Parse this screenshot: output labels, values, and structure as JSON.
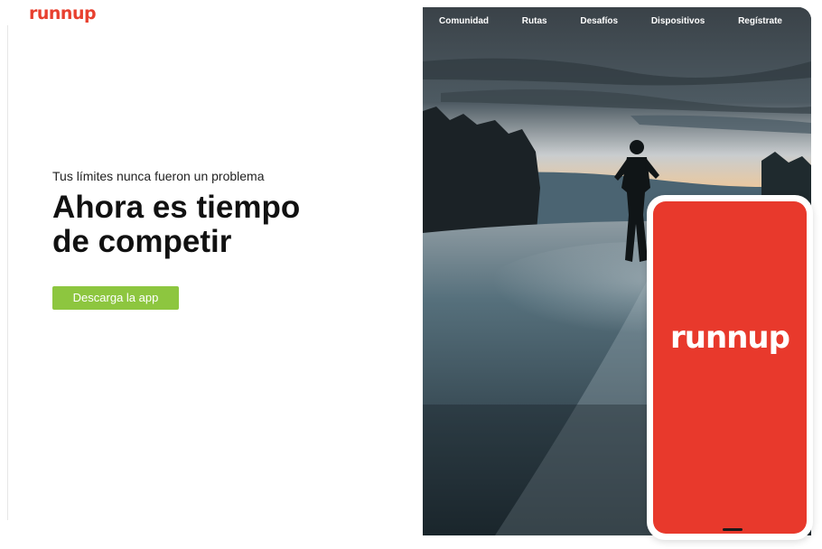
{
  "brand": {
    "logo": "runnup",
    "color": "#e8402f"
  },
  "hero": {
    "subtitle": "Tus límites nunca fueron un problema",
    "headline": "Ahora es tiempo de competir",
    "cta_label": "Descarga la app",
    "cta_color": "#8dc63f"
  },
  "nav": {
    "items": [
      {
        "label": "Comunidad"
      },
      {
        "label": "Rutas"
      },
      {
        "label": "Desafíos"
      },
      {
        "label": "Dispositivos"
      },
      {
        "label": "Regístrate"
      }
    ]
  },
  "phone": {
    "logo": "runnup",
    "screen_color": "#e8392c"
  },
  "photo": {
    "description_icon": "runner-on-road-photo"
  }
}
